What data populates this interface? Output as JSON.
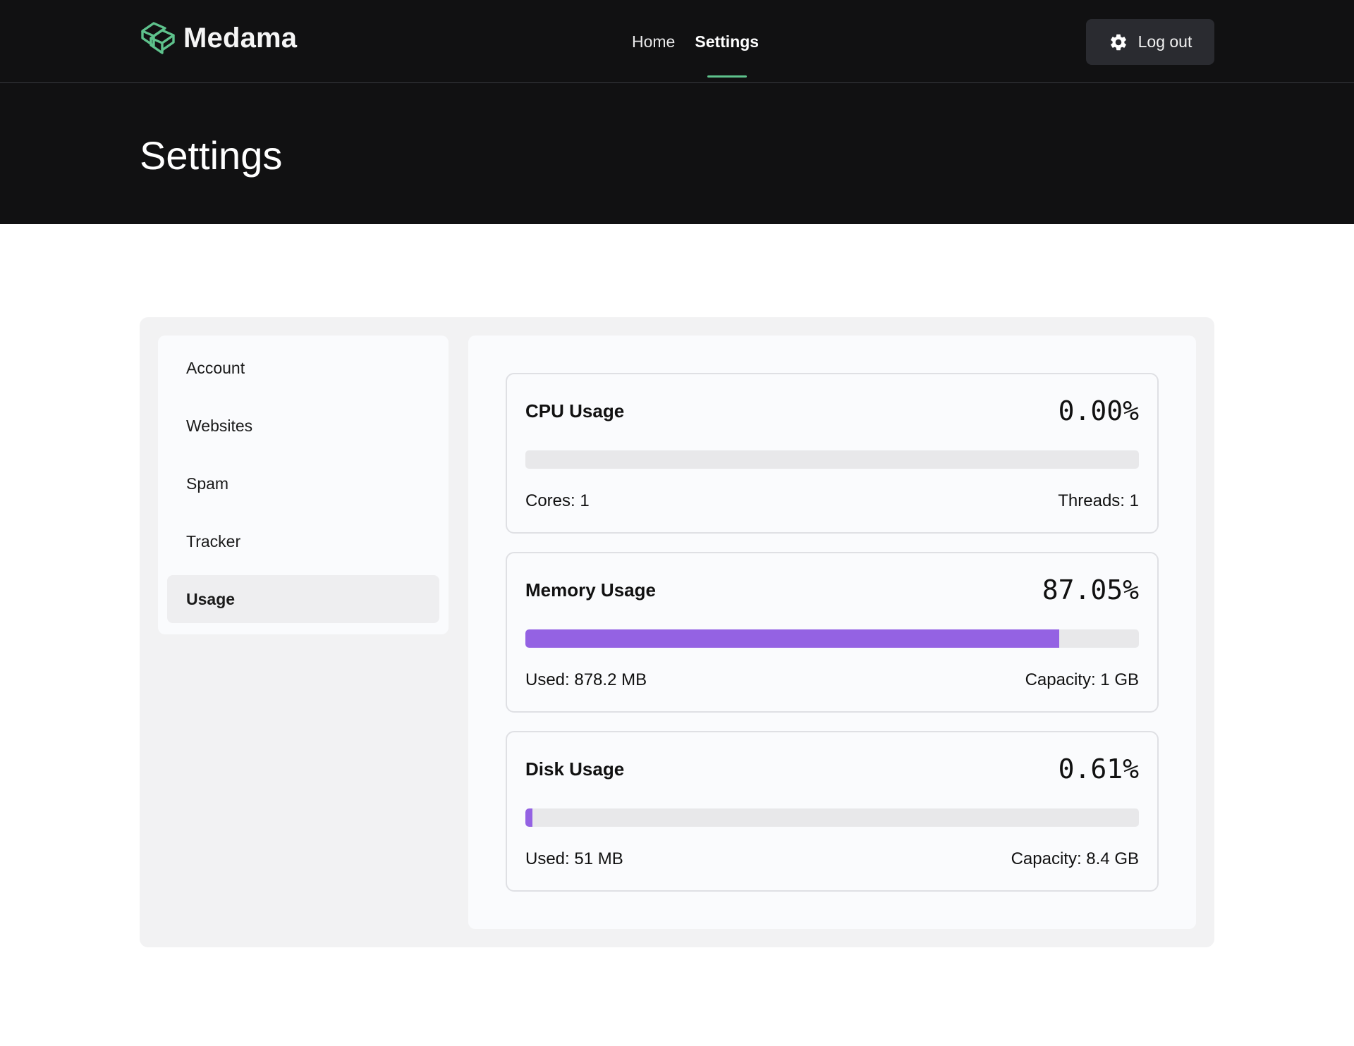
{
  "brand": {
    "name": "Medama",
    "accent": "#5ec28c"
  },
  "nav": {
    "items": [
      {
        "label": "Home",
        "active": false
      },
      {
        "label": "Settings",
        "active": true
      }
    ]
  },
  "header": {
    "logout_label": "Log out",
    "logout_icon": "gear-icon",
    "page_title": "Settings"
  },
  "sidebar": {
    "items": [
      {
        "label": "Account",
        "active": false
      },
      {
        "label": "Websites",
        "active": false
      },
      {
        "label": "Spam",
        "active": false
      },
      {
        "label": "Tracker",
        "active": false
      },
      {
        "label": "Usage",
        "active": true
      }
    ]
  },
  "usage": {
    "bar_color": "#9462e3",
    "cpu": {
      "title": "CPU Usage",
      "value": "0.00%",
      "percent": 0.0,
      "left": "Cores: 1",
      "right": "Threads: 1"
    },
    "memory": {
      "title": "Memory Usage",
      "value": "87.05%",
      "percent": 87.05,
      "left": "Used: 878.2 MB",
      "right": "Capacity: 1 GB"
    },
    "disk": {
      "title": "Disk Usage",
      "value": "0.61%",
      "percent": 0.61,
      "left": "Used: 51 MB",
      "right": "Capacity: 8.4 GB"
    }
  }
}
